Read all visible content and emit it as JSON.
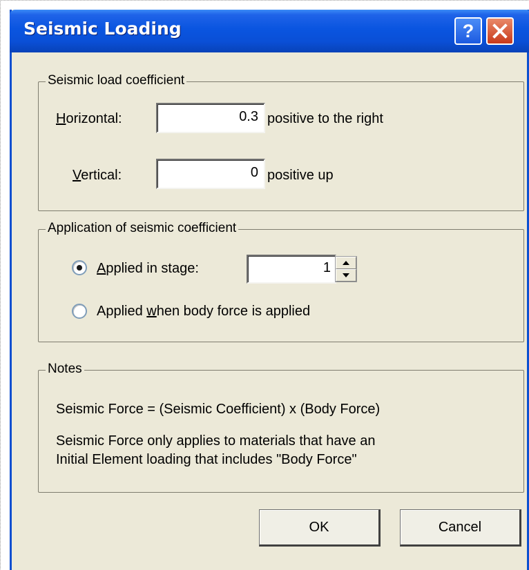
{
  "window": {
    "title": "Seismic Loading",
    "help_glyph": "?",
    "close_icon": "close-icon"
  },
  "seismic_coefficient": {
    "legend": "Seismic load coefficient",
    "horizontal": {
      "label_accel": "H",
      "label_rest": "orizontal:",
      "value": "0.3",
      "note": "positive to the right"
    },
    "vertical": {
      "label_accel": "V",
      "label_rest": "ertical:",
      "value": "0",
      "note": "positive up"
    }
  },
  "application": {
    "legend": "Application of seismic coefficient",
    "option_stage": {
      "label_accel": "A",
      "label_rest": "pplied in stage:",
      "selected": true,
      "stage_value": "1"
    },
    "option_body_force": {
      "label_pre": "Applied ",
      "label_accel": "w",
      "label_post": "hen body force is applied",
      "selected": false
    }
  },
  "notes": {
    "legend": "Notes",
    "line1": "Seismic Force =  (Seismic Coefficient) x (Body Force)",
    "line2": "Seismic Force only applies to materials that have an",
    "line3": "Initial Element loading that includes \"Body Force\""
  },
  "buttons": {
    "ok": "OK",
    "cancel": "Cancel"
  },
  "colors": {
    "titlebar_blue": "#0a55e0",
    "dialog_face": "#ece9d8",
    "close_red": "#c8391a"
  }
}
